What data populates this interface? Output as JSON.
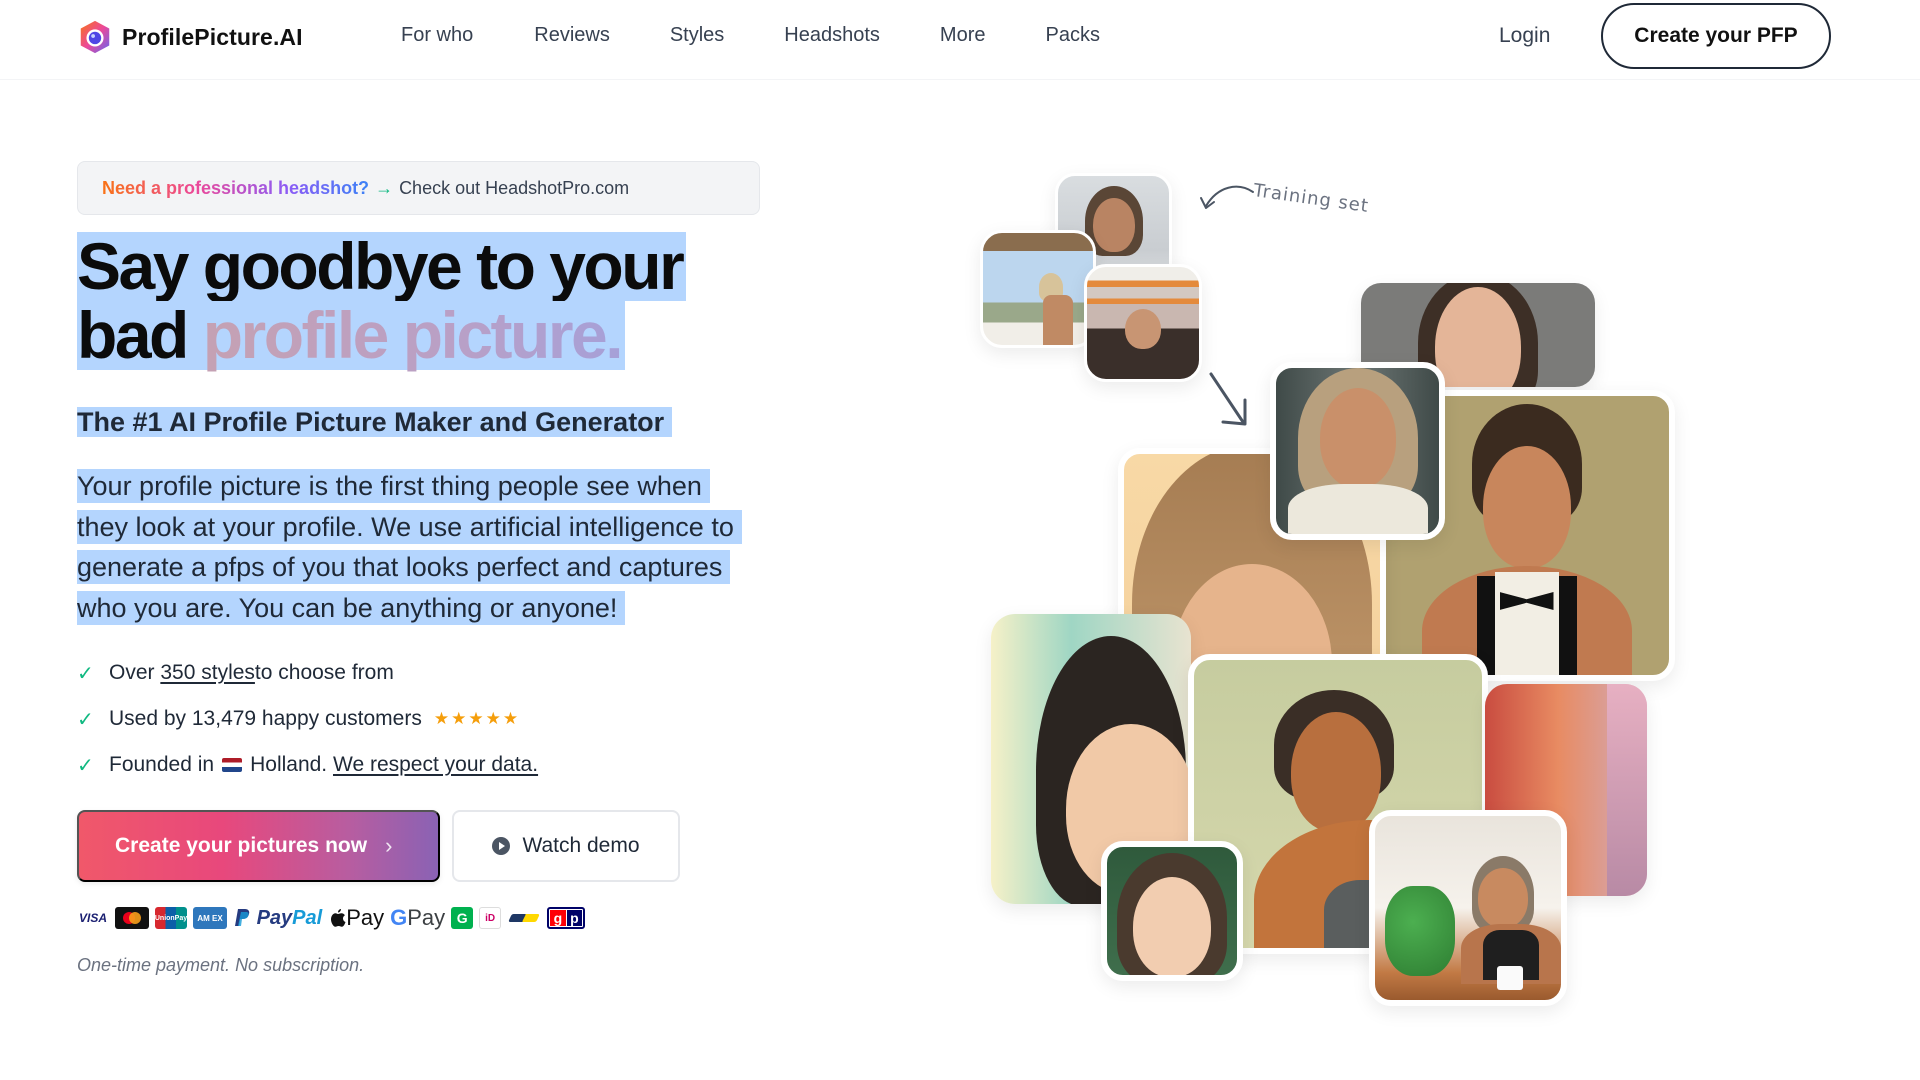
{
  "brand": {
    "name": "ProfilePicture.AI",
    "logo_icon": "camera-hexagon-logo",
    "colors": {
      "primary_gradient_start": "#f0586a",
      "primary_gradient_end": "#8a62b4",
      "check_green": "#10b981",
      "star_amber": "#f59e0b",
      "selection_blue": "#b4d5fe"
    }
  },
  "nav": {
    "links": [
      "For who",
      "Reviews",
      "Styles",
      "Headshots",
      "More",
      "Packs"
    ],
    "login": "Login",
    "cta": "Create your PFP"
  },
  "banner": {
    "highlight": "Need a professional headshot?",
    "arrow": "→",
    "link": "Check out HeadshotPro.com"
  },
  "hero": {
    "headline_line1": "Say goodbye to your",
    "headline_line2_plain": "bad",
    "headline_line2_accent": "profile picture.",
    "subtitle": "The #1 AI Profile Picture Maker and Generator",
    "paragraph": "Your profile picture is the first thing people see when they look at your profile. We use artificial intelligence to generate a pfps of you that looks perfect and captures who you are. You can be anything or anyone!",
    "checklist": [
      {
        "prefix": "Over ",
        "link": "350 styles ",
        "suffix": "to choose from"
      },
      {
        "text": "Used by 13,479 happy customers",
        "rating_stars": 5,
        "stars": "★★★★★"
      },
      {
        "prefix": "Founded in",
        "country": "Holland.",
        "link": "We respect your data."
      }
    ],
    "primary_button": "Create your pictures now",
    "primary_button_chevron": "›",
    "secondary_button": "Watch demo",
    "payment_methods": [
      "Visa",
      "Mastercard",
      "UnionPay",
      "American Express",
      "PayPal",
      "Apple Pay",
      "Google Pay",
      "GrabPay",
      "iDEAL",
      "Bancontact",
      "giropay"
    ],
    "payment_labels": {
      "visa": "VISA",
      "union": "UnionPay",
      "amex": "AM EX",
      "paypal_a": "Pay",
      "paypal_b": "Pal",
      "applepay": "Pay",
      "gpay_g": "G",
      "gpay": " Pay",
      "grab": "G",
      "ideal": "iD",
      "giro_g": "g",
      "giro_p": "p"
    },
    "footnote": "One-time payment. No subscription."
  },
  "collage": {
    "training_label": "Training set",
    "training_photos": [
      "selfie-indoor",
      "beach-bar",
      "store-peace-sign"
    ],
    "generated_photos": [
      "grey-portrait",
      "sleeveless-top-portrait",
      "tuxedo-bowtie-portrait",
      "anime-bun-portrait",
      "anime-headband-portrait",
      "over-shoulder-portrait",
      "painterly-closeup-portrait",
      "anime-green-eyes-portrait",
      "cafe-smiling-photo"
    ]
  }
}
